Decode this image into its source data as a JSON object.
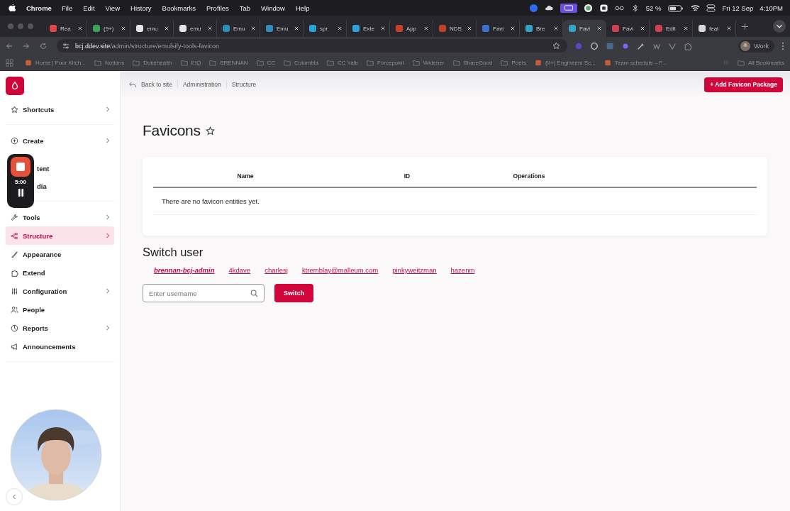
{
  "menubar": {
    "app": "Chrome",
    "menus": [
      "File",
      "Edit",
      "View",
      "History",
      "Bookmarks",
      "Profiles",
      "Tab",
      "Window",
      "Help"
    ],
    "battery": "52 %",
    "date": "Fri 12 Sep",
    "time": "4:10PM"
  },
  "tabs": [
    {
      "title": "Rea",
      "selected": false,
      "color": "#e04848"
    },
    {
      "title": "(9+)",
      "selected": false,
      "color": "#3aa35a"
    },
    {
      "title": "emu",
      "selected": false,
      "color": "#e6e6e6"
    },
    {
      "title": "emu",
      "selected": false,
      "color": "#e6e6e6"
    },
    {
      "title": "Emu",
      "selected": false,
      "color": "#2f8fb8"
    },
    {
      "title": "Emu",
      "selected": false,
      "color": "#2f8fb8"
    },
    {
      "title": "spr",
      "selected": false,
      "color": "#2aa3d8"
    },
    {
      "title": "Exte",
      "selected": false,
      "color": "#2aa3d8"
    },
    {
      "title": "App",
      "selected": false,
      "color": "#c8402a"
    },
    {
      "title": "NDS",
      "selected": false,
      "color": "#c8402a"
    },
    {
      "title": "Favi",
      "selected": false,
      "color": "#3b6fd0"
    },
    {
      "title": "Bre",
      "selected": false,
      "color": "#36a4c9"
    },
    {
      "title": "Favi",
      "selected": true,
      "color": "#36a4c9"
    },
    {
      "title": "Favi",
      "selected": false,
      "color": "#d04050"
    },
    {
      "title": "Edit",
      "selected": false,
      "color": "#d04050"
    },
    {
      "title": "feat",
      "selected": false,
      "color": "#d8d8d8"
    }
  ],
  "address_bar": {
    "host": "bcj.ddev.site",
    "path": "/admin/structure/emulsify-tools-favicon"
  },
  "profile": "Work",
  "bookmarks": [
    {
      "label": "Home | Four Kitch...",
      "kind": "site"
    },
    {
      "label": "Notions",
      "kind": "folder"
    },
    {
      "label": "Dukehealth",
      "kind": "folder"
    },
    {
      "label": "EIQ",
      "kind": "folder"
    },
    {
      "label": "BRENNAN",
      "kind": "folder"
    },
    {
      "label": "CC",
      "kind": "folder"
    },
    {
      "label": "Columbia",
      "kind": "folder"
    },
    {
      "label": "CC Yale",
      "kind": "folder"
    },
    {
      "label": "Forcepoint",
      "kind": "folder"
    },
    {
      "label": "Widener",
      "kind": "folder"
    },
    {
      "label": "ShareGood",
      "kind": "folder"
    },
    {
      "label": "Poets",
      "kind": "folder"
    },
    {
      "label": "(9+) Engineers Sc...",
      "kind": "site"
    },
    {
      "label": "Team schedule – F...",
      "kind": "site"
    }
  ],
  "all_bookmarks": "All Bookmarks",
  "recorder": {
    "timer": "5:00"
  },
  "sidebar": {
    "sections": [
      {
        "items": [
          {
            "label": "Shortcuts",
            "kind": "link",
            "expandable": true,
            "selected": false
          }
        ]
      },
      {
        "items": [
          {
            "label": "Create",
            "kind": "link",
            "expandable": true,
            "selected": false
          },
          {
            "label": "tent",
            "kind": "partial",
            "expandable": false,
            "selected": false
          },
          {
            "label": "dia",
            "kind": "partial",
            "expandable": false,
            "selected": false
          }
        ]
      },
      {
        "items": [
          {
            "label": "Tools",
            "kind": "link",
            "expandable": true,
            "selected": false
          },
          {
            "label": "Structure",
            "kind": "link",
            "expandable": true,
            "selected": true
          },
          {
            "label": "Appearance",
            "kind": "link",
            "expandable": false,
            "selected": false
          },
          {
            "label": "Extend",
            "kind": "link",
            "expandable": false,
            "selected": false
          },
          {
            "label": "Configuration",
            "kind": "link",
            "expandable": true,
            "selected": false
          },
          {
            "label": "People",
            "kind": "link",
            "expandable": false,
            "selected": false
          },
          {
            "label": "Reports",
            "kind": "link",
            "expandable": true,
            "selected": false
          },
          {
            "label": "Announcements",
            "kind": "link",
            "expandable": false,
            "selected": false
          }
        ]
      }
    ]
  },
  "breadcrumb": [
    "Back to site",
    "Administration",
    "Structure"
  ],
  "action_button": "+ Add Favicon Package",
  "title": "Favicons",
  "table": {
    "columns": [
      "Name",
      "ID",
      "Operations"
    ],
    "empty_message": "There are no favicon entities yet."
  },
  "switch_user": {
    "heading": "Switch user",
    "users": [
      {
        "name": "brennan-bcj-admin",
        "selected": true
      },
      {
        "name": "4kdave",
        "selected": false
      },
      {
        "name": "charlesj",
        "selected": false
      },
      {
        "name": "ktremblay@malleum.com",
        "selected": false
      },
      {
        "name": "pinkyweitzman",
        "selected": false
      },
      {
        "name": "hazenm",
        "selected": false
      }
    ],
    "placeholder": "Enter username",
    "button": "Switch"
  }
}
